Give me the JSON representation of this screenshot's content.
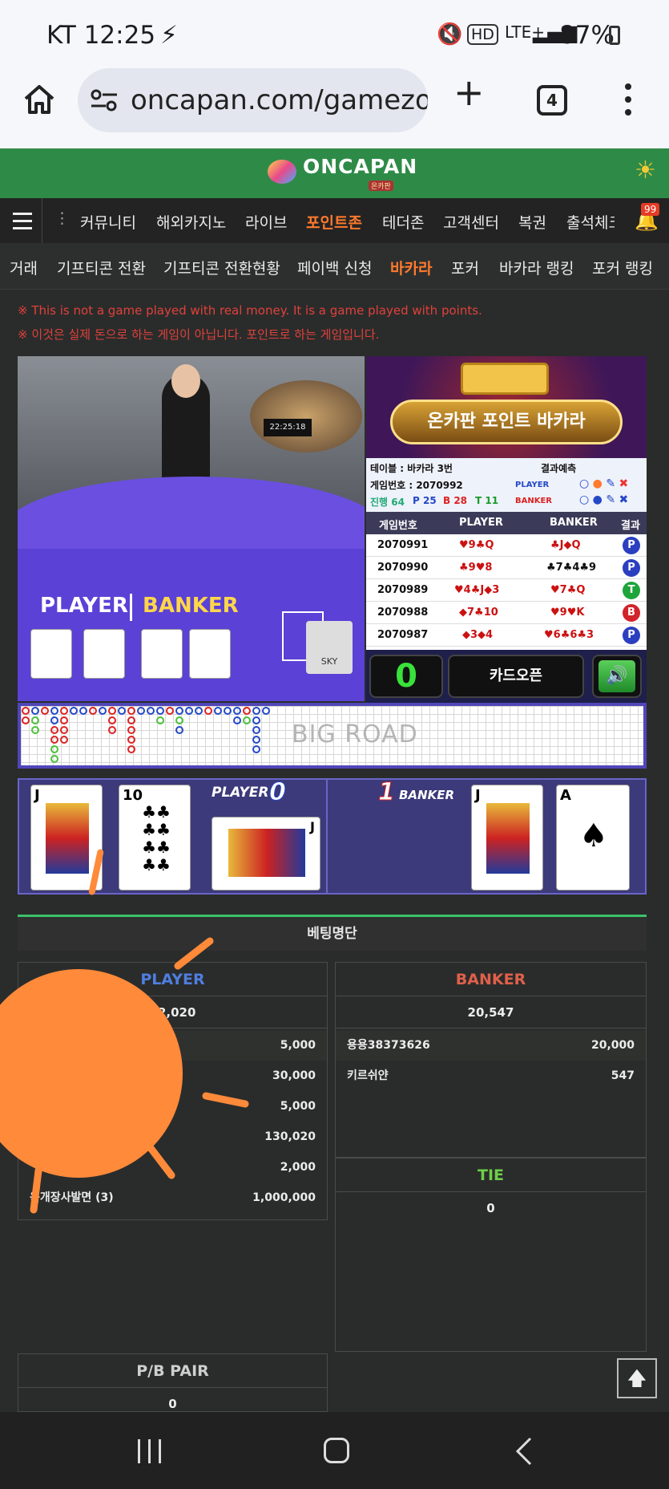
{
  "status_bar": {
    "carrier_time": "KT 12:25",
    "signal": "LTE+",
    "battery": "87%"
  },
  "browser": {
    "url": "oncapan.com/gamezo",
    "tab_count": "4"
  },
  "site": {
    "logo": "ONCAPAN",
    "logo_sub": "온카판"
  },
  "menu": {
    "items": [
      "커뮤니티",
      "해외카지노",
      "라이브",
      "포인트존",
      "테더존",
      "고객센터",
      "복권",
      "출석체크"
    ],
    "active": "포인트존",
    "notifications": "99"
  },
  "submenu": {
    "items": [
      "거래",
      "기프티콘 전환",
      "기프티콘 전환현황",
      "페이백 신청",
      "바카라",
      "포커",
      "바카라 랭킹",
      "포커 랭킹"
    ],
    "active": "바카라"
  },
  "notice": {
    "en": "※ This is not a game played with real money. It is a game played with points.",
    "ko": "※ 이것은 실제 돈으로 하는 게임이 아닙니다. 포인트로 하는 게임입니다."
  },
  "video": {
    "clock": "22:25:18",
    "player_label": "PLAYER",
    "banker_label": "BANKER",
    "card_shoe": "SKY"
  },
  "game_banner": {
    "title": "온카판 포인트 바카라"
  },
  "game_info": {
    "table": "테이블 : 바카라 3번",
    "game_no": "게임번호 : 2070992",
    "progress": "진행 64",
    "p_count": "P 25",
    "b_count": "B 28",
    "t_count": "T 11",
    "forecast": "결과예측",
    "player": "PLAYER",
    "banker": "BANKER"
  },
  "results": {
    "headers": [
      "게임번호",
      "PLAYER",
      "BANKER",
      "결과"
    ],
    "rows": [
      {
        "no": "2070991",
        "player": "♥9♣Q",
        "banker": "♣J◆Q",
        "result": "P"
      },
      {
        "no": "2070990",
        "player": "♣9♥8",
        "banker": "♣7♣4♣9",
        "result": "P"
      },
      {
        "no": "2070989",
        "player": "♥4♣J◆3",
        "banker": "♥7♣Q",
        "result": "T"
      },
      {
        "no": "2070988",
        "player": "◆7♣10",
        "banker": "♥9♥K",
        "result": "B"
      },
      {
        "no": "2070987",
        "player": "◆3◆4",
        "banker": "♥6♣6♣3",
        "result": "P"
      }
    ]
  },
  "controls": {
    "timer": "0",
    "card_open": "카드오픈"
  },
  "road": {
    "label": "BIG ROAD"
  },
  "dealt": {
    "player_label": "PLAYER",
    "player_score": "0",
    "banker_label": "BANKER",
    "banker_score": "1",
    "player_cards": [
      "J",
      "10",
      "J"
    ],
    "banker_cards": [
      "J",
      "A"
    ]
  },
  "bets": {
    "heading": "베팅명단",
    "player": {
      "title": "PLAYER",
      "total": "82,020",
      "rows": [
        {
          "name": "",
          "amount": "5,000"
        },
        {
          "name": "",
          "amount": "30,000"
        },
        {
          "name": "",
          "amount": "5,000"
        },
        {
          "name": "",
          "amount": "130,020"
        },
        {
          "name": "",
          "amount": "2,000"
        },
        {
          "name": "육개장사발면 (3)",
          "amount": "1,000,000"
        }
      ]
    },
    "banker": {
      "title": "BANKER",
      "total": "20,547",
      "rows": [
        {
          "name": "용용38373626",
          "amount": "20,000"
        },
        {
          "name": "키르쉬얀",
          "amount": "547"
        }
      ]
    },
    "tie": {
      "title": "TIE",
      "total": "0"
    },
    "pair": {
      "title": "P/B PAIR",
      "total": "0"
    }
  },
  "colors": {
    "green_header": "#2e8b47",
    "accent_orange": "#ff7a2d",
    "player_blue": "#4f7ee0",
    "banker_red": "#e0604a",
    "tie_green": "#6ecf4a"
  }
}
